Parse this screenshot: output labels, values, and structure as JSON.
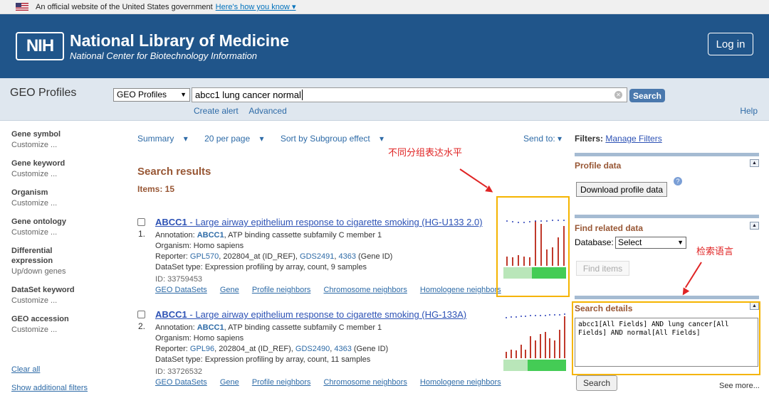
{
  "gov_banner": {
    "text": "An official website of the United States government",
    "link": "Here's how you know"
  },
  "header": {
    "logo_text": "NIH",
    "title": "National Library of Medicine",
    "subtitle": "National Center for Biotechnology Information",
    "login_label": "Log in",
    "brand_color": "#20558a"
  },
  "search": {
    "db_title": "GEO Profiles",
    "db_selected": "GEO Profiles",
    "query": "abcc1 lung cancer normal",
    "search_label": "Search",
    "create_alert": "Create alert",
    "advanced": "Advanced",
    "help": "Help"
  },
  "sidebar": {
    "facets": [
      {
        "title": "Gene symbol",
        "link": "Customize ..."
      },
      {
        "title": "Gene keyword",
        "link": "Customize ..."
      },
      {
        "title": "Organism",
        "link": "Customize ..."
      },
      {
        "title": "Gene ontology",
        "link": "Customize ..."
      },
      {
        "title": "Differential expression",
        "link": "Up/down genes"
      },
      {
        "title": "DataSet keyword",
        "link": "Customize ..."
      },
      {
        "title": "GEO accession",
        "link": "Customize ..."
      }
    ],
    "clear_all": "Clear all",
    "show_filters": "Show additional filters"
  },
  "toolbar": {
    "summary": "Summary",
    "per_page": "20 per page",
    "sort": "Sort by Subgroup effect",
    "send_to": "Send to:"
  },
  "results": {
    "title": "Search results",
    "items": "Items: 15",
    "list": [
      {
        "num": "1.",
        "gene": "ABCC1",
        "title_rest": " - Large airway epithelium response to cigarette smoking (HG-U133 2.0)",
        "annotation_label": "Annotation: ",
        "annotation_gene": "ABCC1",
        "annotation_rest": ", ATP binding cassette subfamily C member 1",
        "organism": "Organism: Homo sapiens",
        "reporter_label": "Reporter: ",
        "reporter_gpl": "GPL570",
        "reporter_mid": ", 202804_at (ID_REF), ",
        "reporter_gds": "GDS2491",
        "reporter_sep": ", ",
        "reporter_gene_id": "4363",
        "reporter_end": " (Gene ID)",
        "dataset_type": "DataSet type: Expression profiling by array, count, 9 samples",
        "id": "ID: 33759453",
        "links": [
          "GEO DataSets",
          "Gene",
          "Profile neighbors",
          "Chromosome neighbors",
          "Homologene neighbors"
        ]
      },
      {
        "num": "2.",
        "gene": "ABCC1",
        "title_rest": " - Large airway epithelium response to cigarette smoking (HG-133A)",
        "annotation_label": "Annotation: ",
        "annotation_gene": "ABCC1",
        "annotation_rest": ", ATP binding cassette subfamily C member 1",
        "organism": "Organism: Homo sapiens",
        "reporter_label": "Reporter: ",
        "reporter_gpl": "GPL96",
        "reporter_mid": ", 202804_at (ID_REF), ",
        "reporter_gds": "GDS2490",
        "reporter_sep": ", ",
        "reporter_gene_id": "4363",
        "reporter_end": " (Gene ID)",
        "dataset_type": "DataSet type: Expression profiling by array, count, 11 samples",
        "id": "ID: 33726532",
        "links": [
          "GEO DataSets",
          "Gene",
          "Profile neighbors",
          "Chromosome neighbors",
          "Homologene neighbors"
        ]
      }
    ]
  },
  "annotations": {
    "profile_note": "不同分组表达水平",
    "search_note": "检索语言",
    "highlight_color": "#f5b400",
    "note_color": "#e02424"
  },
  "right": {
    "filters_label": "Filters:",
    "manage_filters": "Manage Filters",
    "profile_data_title": "Profile data",
    "download_label": "Download profile data",
    "find_related_title": "Find related data",
    "database_label": "Database:",
    "database_selected": "Select",
    "find_items_label": "Find items",
    "search_details_title": "Search details",
    "search_details_text": "abcc1[All Fields] AND lung cancer[All Fields] AND normal[All Fields]",
    "search_btn": "Search",
    "see_more": "See more..."
  }
}
